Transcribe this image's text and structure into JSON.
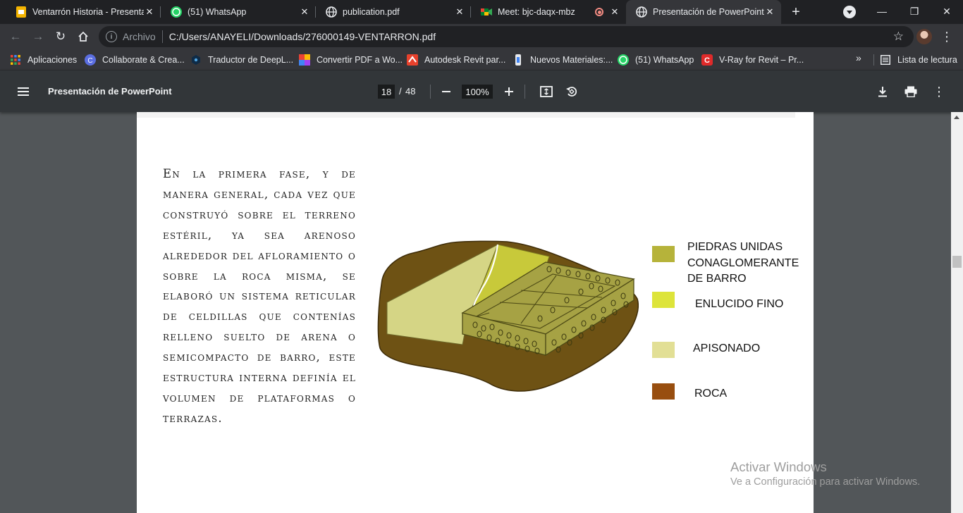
{
  "browser": {
    "tabs": [
      {
        "title": "Ventarrón Historia - Presentaci",
        "icon": "slides-icon"
      },
      {
        "title": "(51) WhatsApp",
        "icon": "whatsapp-icon"
      },
      {
        "title": "publication.pdf",
        "icon": "globe-icon"
      },
      {
        "title": "Meet: bjc-daqx-mbz",
        "icon": "meet-icon"
      },
      {
        "title": "Presentación de PowerPoint",
        "icon": "globe-icon",
        "active": true
      }
    ],
    "address": {
      "scheme": "Archivo",
      "url": "C:/Users/ANAYELI/Downloads/276000149-VENTARRON.pdf"
    },
    "bookmarks": [
      "Aplicaciones",
      "Collaborate & Crea...",
      "Traductor de DeepL...",
      "Convertir PDF a Wo...",
      "Autodesk Revit par...",
      "Nuevos Materiales:...",
      "(51) WhatsApp",
      "V-Ray for Revit – Pr..."
    ],
    "more_bookmarks": "»",
    "reading_list": "Lista de lectura"
  },
  "pdf_viewer": {
    "title": "Presentación de PowerPoint",
    "current_page": "18",
    "page_separator": "/",
    "total_pages": "48",
    "zoom": "100%"
  },
  "document": {
    "body_text": "En la primera fase, y de manera general, cada vez que construyó sobre el terreno estéril, ya sea arenoso alrededor del afloramiento o sobre la roca misma, se elaboró un sistema reticular de celdillas que contenías relleno suelto de arena o semicompacto de barro, este estructura interna definía el volumen de plataformas o terrazas.",
    "legend": [
      {
        "label": "PIEDRAS UNIDAS\nCONAGLOMERANTE\nDE BARRO",
        "color": "#b6b33a"
      },
      {
        "label": "ENLUCIDO FINO",
        "color": "#dde43a"
      },
      {
        "label": "APISONADO",
        "color": "#e2df95"
      },
      {
        "label": "ROCA",
        "color": "#984e0f"
      }
    ],
    "illustration_colors": {
      "rock": "#6e5214",
      "apisonado": "#d5d585",
      "enlucido": "#c8c93a",
      "stones": "#a6a244"
    }
  },
  "watermark": {
    "line1": "Activar Windows",
    "line2": "Ve a Configuración para activar Windows."
  }
}
